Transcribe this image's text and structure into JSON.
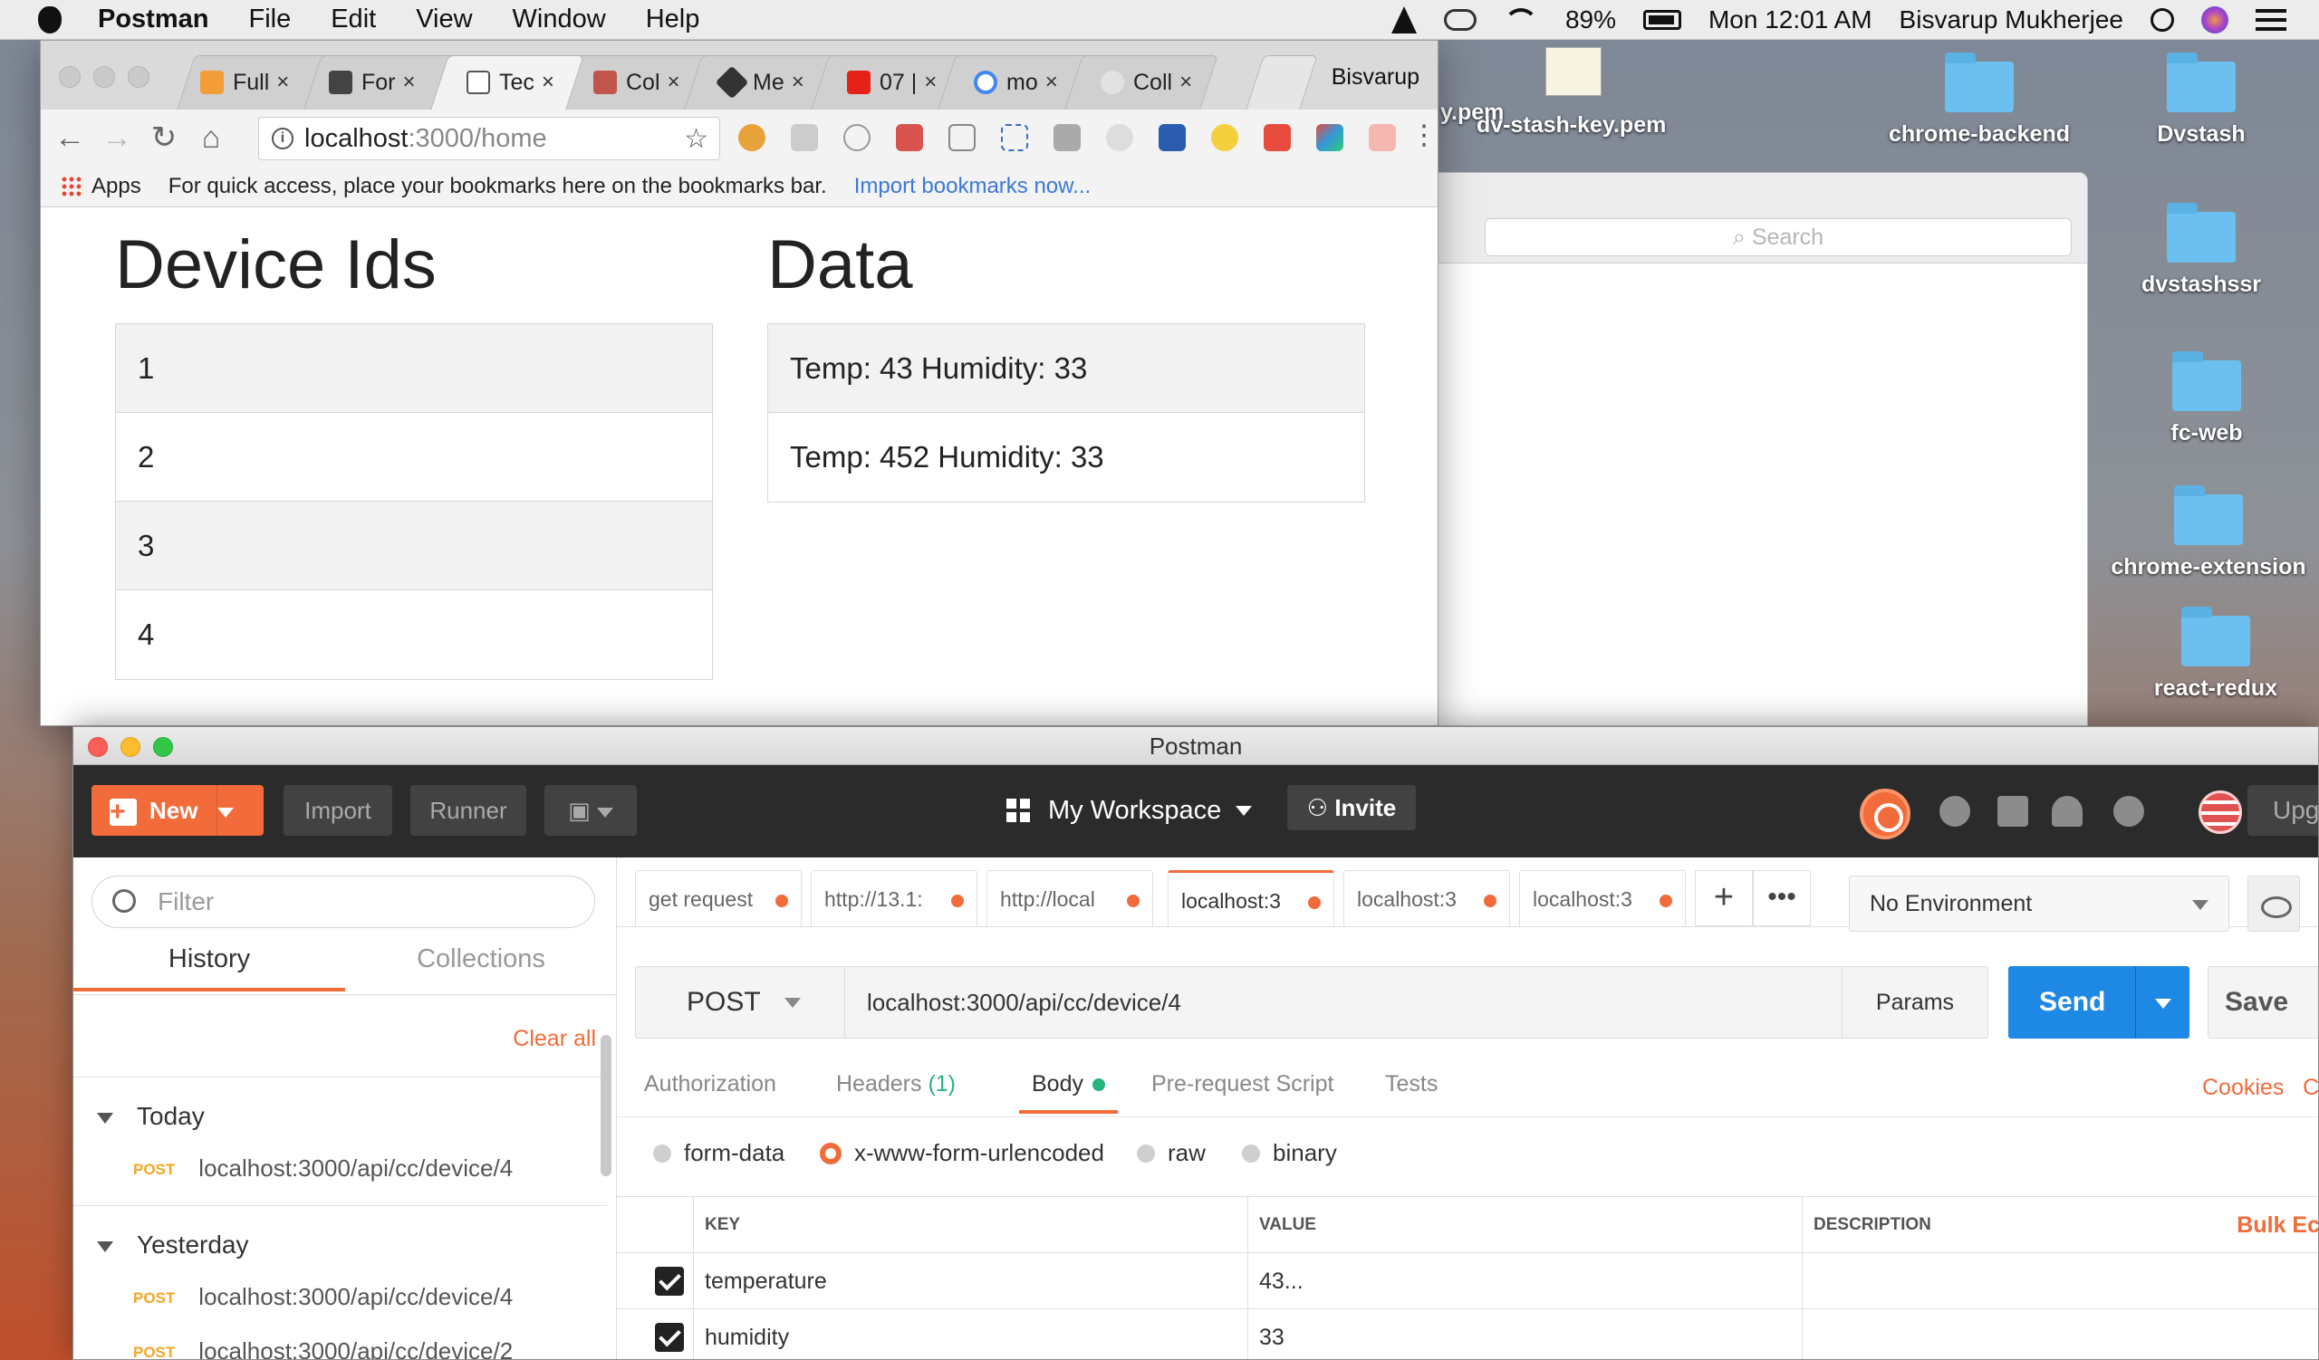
{
  "menubar": {
    "app": "Postman",
    "items": [
      "File",
      "Edit",
      "View",
      "Window",
      "Help"
    ],
    "battery": "89%",
    "clock": "Mon 12:01 AM",
    "user": "Bisvarup Mukherjee"
  },
  "desktop": {
    "files": [
      "y.pem",
      "dv-stash-key.pem"
    ],
    "folders": [
      "chrome-backend",
      "Dvstash",
      "dvstashssr",
      "fc-web",
      "chrome-extension",
      "react-redux"
    ],
    "finder_search": "Search"
  },
  "chrome": {
    "tabs": [
      {
        "label": "Full",
        "color": "#f29d38"
      },
      {
        "label": "For",
        "color": "#444444"
      },
      {
        "label": "Tec",
        "color": "#ffffff"
      },
      {
        "label": "Col",
        "color": "#c0564b"
      },
      {
        "label": "Me",
        "color": "#333333"
      },
      {
        "label": "07 |",
        "color": "#e62117"
      },
      {
        "label": "mo",
        "color": "#4285f4"
      },
      {
        "label": "Coll",
        "color": "#cfcfcf"
      }
    ],
    "profile": "Bisvarup",
    "url_host": "localhost",
    "url_path": ":3000/home",
    "bookmarks_apps": "Apps",
    "bookmarks_hint": "For quick access, place your bookmarks here on the bookmarks bar.",
    "bookmarks_import": "Import bookmarks now..."
  },
  "page": {
    "left_title": "Device Ids",
    "right_title": "Data",
    "device_ids": [
      "1",
      "2",
      "3",
      "4"
    ],
    "data_rows": [
      "Temp: 43 Humidity: 33",
      "Temp: 452 Humidity: 33"
    ]
  },
  "postman": {
    "window_title": "Postman",
    "new_label": "New",
    "import_label": "Import",
    "runner_label": "Runner",
    "workspace": "My Workspace",
    "invite": "Invite",
    "upgrade": "Upgrade",
    "sidebar": {
      "filter_placeholder": "Filter",
      "tab_history": "History",
      "tab_collections": "Collections",
      "clear_all": "Clear all",
      "groups": [
        {
          "name": "Today",
          "entries": [
            {
              "method": "POST",
              "url": "localhost:3000/api/cc/device/4"
            }
          ]
        },
        {
          "name": "Yesterday",
          "entries": [
            {
              "method": "POST",
              "url": "localhost:3000/api/cc/device/4"
            },
            {
              "method": "POST",
              "url": "localhost:3000/api/cc/device/2"
            }
          ]
        }
      ]
    },
    "request_tabs": [
      "get request",
      "http://13.1:",
      "http://local",
      "localhost:3",
      "localhost:3",
      "localhost:3"
    ],
    "environment": "No Environment",
    "method": "POST",
    "url": "localhost:3000/api/cc/device/4",
    "params": "Params",
    "send": "Send",
    "save": "Save",
    "subtabs": {
      "authorization": "Authorization",
      "headers": "Headers",
      "headers_count": "(1)",
      "body": "Body",
      "prerequest": "Pre-request Script",
      "tests": "Tests",
      "cookies": "Cookies",
      "code": "Co"
    },
    "body_modes": [
      "form-data",
      "x-www-form-urlencoded",
      "raw",
      "binary"
    ],
    "table_headers": {
      "key": "KEY",
      "value": "VALUE",
      "description": "DESCRIPTION",
      "bulk": "Bulk Ec"
    },
    "rows": [
      {
        "key": "temperature",
        "value": "43..."
      },
      {
        "key": "humidity",
        "value": "33"
      }
    ]
  }
}
